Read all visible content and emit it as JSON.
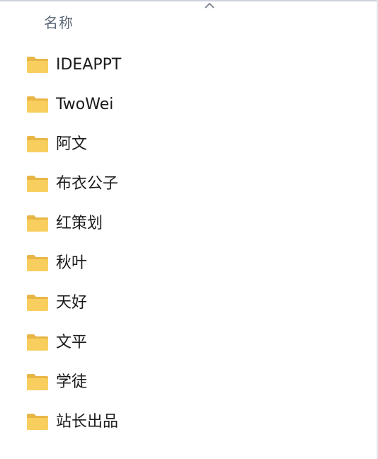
{
  "header": {
    "column_name": "名称"
  },
  "files": [
    {
      "name": "IDEAPPT",
      "icon": "folder-icon"
    },
    {
      "name": "TwoWei",
      "icon": "folder-icon"
    },
    {
      "name": "阿文",
      "icon": "folder-icon"
    },
    {
      "name": "布衣公子",
      "icon": "folder-icon"
    },
    {
      "name": "红策划",
      "icon": "folder-icon"
    },
    {
      "name": "秋叶",
      "icon": "folder-icon"
    },
    {
      "name": "天好",
      "icon": "folder-icon"
    },
    {
      "name": "文平",
      "icon": "folder-icon"
    },
    {
      "name": "学徒",
      "icon": "folder-icon"
    },
    {
      "name": "站长出品",
      "icon": "folder-icon"
    }
  ],
  "colors": {
    "folder_body": "#f8cf5e",
    "folder_back": "#e8b646",
    "header_text": "#5b6677"
  }
}
